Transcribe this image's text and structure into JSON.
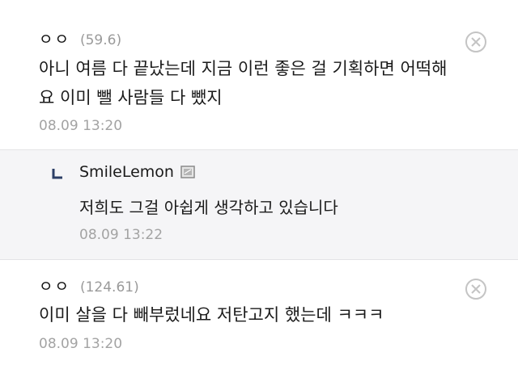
{
  "comments": [
    {
      "author": "ㅇㅇ",
      "score": "(59.6)",
      "lines": [
        "아니 여름 다 끝났는데 지금 이런 좋은 걸 기획하면 어떡해",
        "요 이미 뺄 사람들 다 뺐지"
      ],
      "time": "08.09 13:20"
    },
    {
      "author": "ㅇㅇ",
      "score": "(124.61)",
      "lines": [
        "이미 살을 다 빼부렀네요 저탄고지 했는데 ㅋㅋㅋ"
      ],
      "time": "08.09 13:20"
    }
  ],
  "reply": {
    "author": "SmileLemon",
    "text": "저희도 그걸 아쉽게 생각하고 있습니다",
    "time": "08.09 13:22"
  },
  "icons": {
    "delete": "circle-x-icon",
    "reply_arrow": "reply-arrow-icon",
    "badge": "member-badge-icon"
  },
  "colors": {
    "text": "#1a1a1a",
    "muted": "#a3a3a3",
    "reply_bg": "#f5f5f7",
    "divider": "#e3e3e6"
  }
}
